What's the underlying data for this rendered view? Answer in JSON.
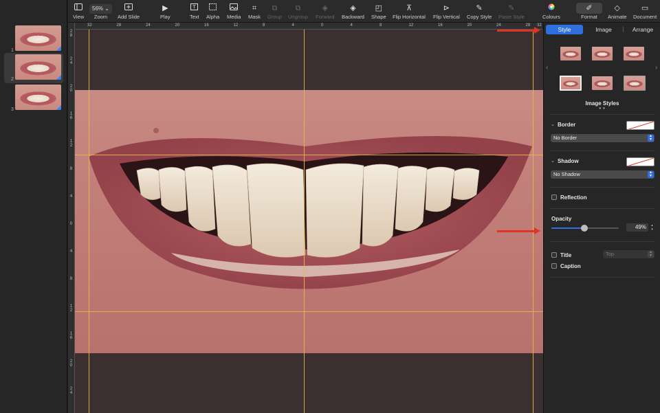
{
  "slides": [
    {
      "number": "1",
      "selected": false
    },
    {
      "number": "2",
      "selected": true
    },
    {
      "number": "3",
      "selected": false
    }
  ],
  "toolbar": {
    "view": "View",
    "zoom_value": "56%",
    "zoom": "Zoom",
    "add_slide": "Add Slide",
    "play": "Play",
    "text": "Text",
    "alpha": "Alpha",
    "media": "Media",
    "mask": "Mask",
    "group": "Group",
    "ungroup": "Ungroup",
    "forward": "Forward",
    "backward": "Backward",
    "shape": "Shape",
    "flip_horizontal": "Flip Horizontal",
    "flip_vertical": "Flip Vertical",
    "copy_style": "Copy Style",
    "paste_style": "Paste Style",
    "colours": "Colours",
    "format": "Format",
    "animate": "Animate",
    "document": "Document"
  },
  "ruler_top": [
    "32",
    "28",
    "24",
    "20",
    "16",
    "12",
    "8",
    "4",
    "0",
    "4",
    "8",
    "12",
    "16",
    "20",
    "24",
    "28",
    "32"
  ],
  "ruler_left": [
    "28",
    "24",
    "20",
    "16",
    "12",
    "8",
    "4",
    "0",
    "4",
    "8",
    "12",
    "16",
    "20",
    "24"
  ],
  "inspector": {
    "tabs": {
      "style": "Style",
      "image": "Image",
      "arrange": "Arrange"
    },
    "image_styles_label": "Image Styles",
    "border": {
      "label": "Border",
      "value": "No Border"
    },
    "shadow": {
      "label": "Shadow",
      "value": "No Shadow"
    },
    "reflection": {
      "label": "Reflection",
      "checked": false
    },
    "opacity": {
      "label": "Opacity",
      "value_text": "49%",
      "value": 49
    },
    "title": {
      "label": "Title",
      "checked": false,
      "position": "Top"
    },
    "caption": {
      "label": "Caption",
      "checked": false
    }
  },
  "colors": {
    "accent": "#2f6fde",
    "arrow": "#e03326",
    "guide": "#e6b84a"
  }
}
